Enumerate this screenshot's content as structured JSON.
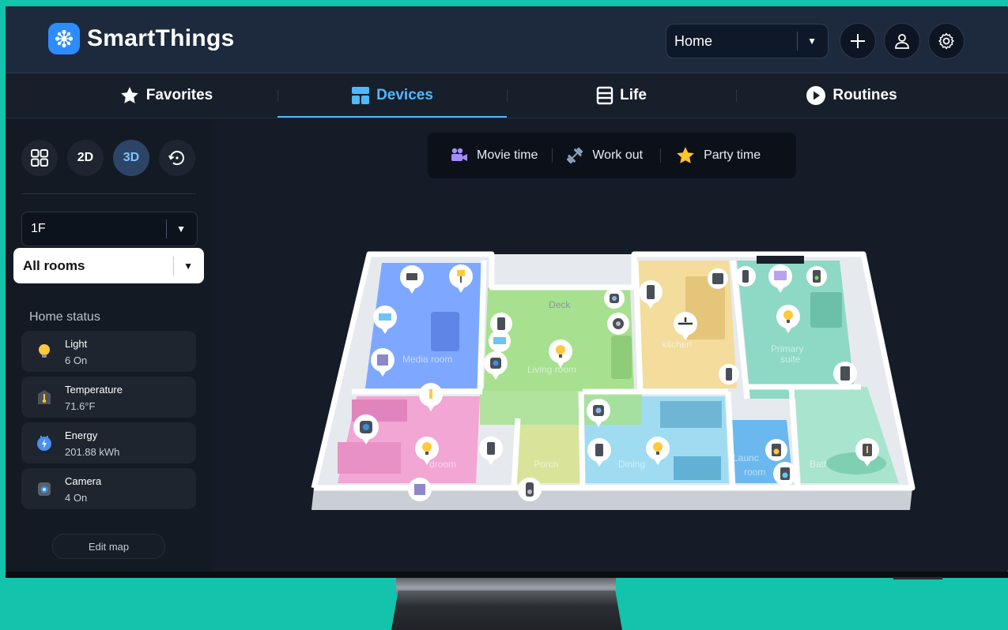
{
  "app": {
    "name": "SmartThings"
  },
  "header": {
    "home_select": "Home"
  },
  "tabs": [
    {
      "label": "Favorites",
      "icon": "star-icon",
      "active": false
    },
    {
      "label": "Devices",
      "icon": "devices-icon",
      "active": true
    },
    {
      "label": "Life",
      "icon": "life-icon",
      "active": false
    },
    {
      "label": "Routines",
      "icon": "play-icon",
      "active": false
    }
  ],
  "view_modes": {
    "grid": "grid-view",
    "two_d": "2D",
    "three_d": "3D",
    "active": "3D"
  },
  "sidebar": {
    "floor": "1F",
    "rooms": "All rooms",
    "status_title": "Home status",
    "status": [
      {
        "label": "Light",
        "value": "6 On",
        "icon": "bulb-icon"
      },
      {
        "label": "Temperature",
        "value": "71.6°F",
        "icon": "thermometer-icon"
      },
      {
        "label": "Energy",
        "value": "201.88 kWh",
        "icon": "energy-icon"
      },
      {
        "label": "Camera",
        "value": "4 On",
        "icon": "camera-icon"
      }
    ],
    "edit_map": "Edit map"
  },
  "scenes": [
    {
      "label": "Movie time",
      "icon": "movie-camera-icon"
    },
    {
      "label": "Work out",
      "icon": "dumbbell-icon"
    },
    {
      "label": "Party time",
      "icon": "star-icon"
    }
  ],
  "map": {
    "rooms": [
      "Media room",
      "Deck",
      "Living room",
      "kitchen",
      "Primary suite",
      "Bedroom",
      "Porch",
      "Dining room",
      "Laundry room",
      "Bathroom"
    ],
    "visible_labels": {
      "media": "Media room",
      "deck": "Deck",
      "living": "Living room",
      "kitchen": "kitchen",
      "primary_1": "Primary",
      "primary_2": "suite",
      "bedroom": "droom",
      "porch": "Porch",
      "dining": "Dining",
      "dining_suffix": "oo",
      "laundry_1": "Launc",
      "laundry_2": "room",
      "bathroom": "Bathroo"
    }
  },
  "colors": {
    "background": "#13c3ac",
    "accent": "#4fb8ff",
    "media_room": "#7ea8ff",
    "living_room": "#a7e08f",
    "kitchen": "#f3dc9c",
    "primary_suite": "#8ed8c6",
    "bedroom": "#f2a6d3",
    "porch": "#d9e49a",
    "dining": "#9fdcf2",
    "laundry": "#6bb8ee",
    "bathroom": "#a9e4ce",
    "deck": "#b7a4f0"
  }
}
